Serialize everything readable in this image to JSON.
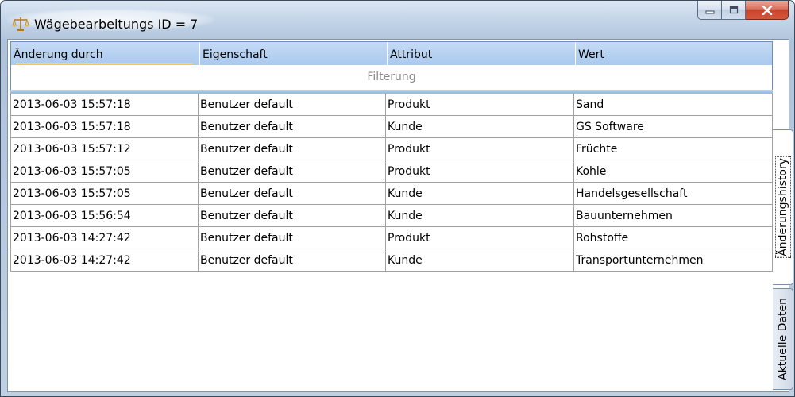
{
  "window": {
    "title": "Wägebearbeitungs ID = 7",
    "icon": "scale-icon",
    "controls": [
      "minimize-icon",
      "maximize-icon",
      "close-icon"
    ]
  },
  "grid": {
    "columns": [
      "Änderung durch",
      "Eigenschaft",
      "Attribut",
      "Wert"
    ],
    "filter_placeholder": "Filterung",
    "rows": [
      [
        "2013-06-03 15:57:18",
        "Benutzer default",
        "Produkt",
        "Sand"
      ],
      [
        "2013-06-03 15:57:18",
        "Benutzer default",
        "Kunde",
        "GS Software"
      ],
      [
        "2013-06-03 15:57:12",
        "Benutzer default",
        "Produkt",
        "Früchte"
      ],
      [
        "2013-06-03 15:57:05",
        "Benutzer default",
        "Produkt",
        "Kohle"
      ],
      [
        "2013-06-03 15:57:05",
        "Benutzer default",
        "Kunde",
        "Handelsgesellschaft"
      ],
      [
        "2013-06-03 15:56:54",
        "Benutzer default",
        "Kunde",
        "Bauunternehmen"
      ],
      [
        "2013-06-03 14:27:42",
        "Benutzer default",
        "Produkt",
        "Rohstoffe"
      ],
      [
        "2013-06-03 14:27:42",
        "Benutzer default",
        "Kunde",
        "Transportunternehmen"
      ]
    ]
  },
  "tabs": {
    "active": "Änderungshistory",
    "inactive": "Aktuelle Daten"
  },
  "colors": {
    "header_bg": "#b8d2f1",
    "close_button": "#c7452c",
    "grid_lines": "#a0a0a0"
  }
}
